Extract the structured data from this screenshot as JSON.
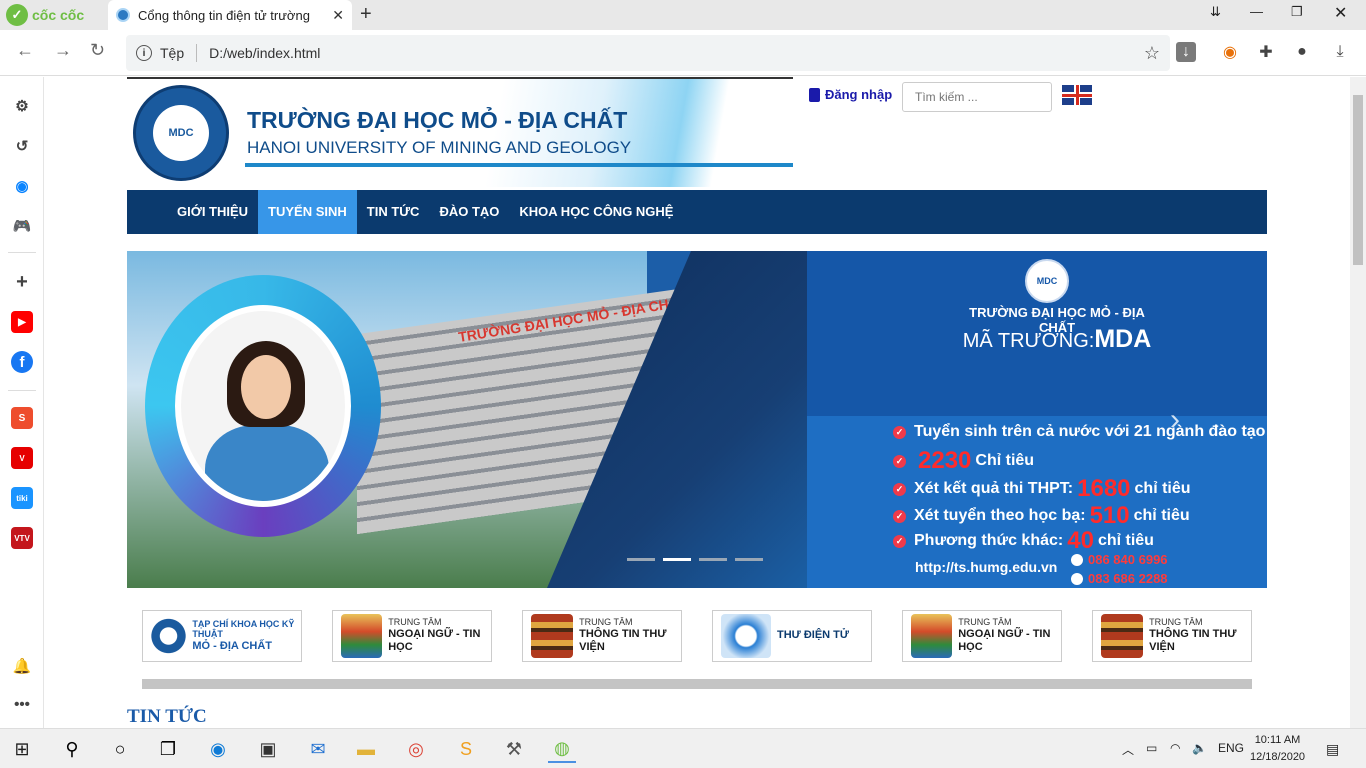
{
  "browser": {
    "brand": "cốc cốc",
    "tab_title": "Cổng thông tin điện tử trường",
    "security_label": "Tệp",
    "url": "D:/web/index.html"
  },
  "header": {
    "name_vn": "TRƯỜNG ĐẠI HỌC MỎ - ĐỊA CHẤT",
    "name_en": "HANOI UNIVERSITY OF MINING AND GEOLOGY",
    "seal_text": "MDC",
    "login": "Đăng nhập",
    "search_placeholder": "Tìm kiếm ..."
  },
  "menu": [
    "GIỚI THIỆU",
    "TUYỂN SINH",
    "TIN TỨC",
    "ĐÀO TẠO",
    "KHOA HỌC CÔNG NGHỆ"
  ],
  "slider": {
    "sign": "TRƯỜNG ĐẠI HỌC MỎ - ĐỊA CHẤT",
    "logo": "MDC",
    "uni": "TRƯỜNG ĐẠI HỌC MỎ - ĐỊA CHẤT",
    "code_prefix": "MÃ TRƯỜNG:",
    "code": "MDA",
    "b1": "Tuyển sinh trên cả nước với 21 ngành đào tạo",
    "b2_num": "2230",
    "b2_text": "Chỉ tiêu",
    "b3_pre": "Xét kết quả thi THPT:",
    "b3_num": "1680",
    "b3_post": "chỉ tiêu",
    "b4_pre": "Xét tuyển theo học bạ:",
    "b4_num": "510",
    "b4_post": "chỉ tiêu",
    "b5_pre": "Phương thức khác:",
    "b5_num": "40",
    "b5_post": "chỉ tiêu",
    "url": "http://ts.humg.edu.vn",
    "phone1": "086 840 6996",
    "phone2": "083 686 2288"
  },
  "quick_links": [
    {
      "small": "TẠP CHÍ KHOA HỌC KỸ THUẬT",
      "big": "MỎ - ĐỊA CHẤT"
    },
    {
      "small": "TRUNG TÂM",
      "big": "NGOẠI NGỮ - TIN HỌC"
    },
    {
      "small": "TRUNG TÂM",
      "big": "THÔNG TIN THƯ VIỆN"
    },
    {
      "small": "",
      "big": "THƯ ĐIỆN TỬ"
    },
    {
      "small": "TRUNG TÂM",
      "big": "NGOẠI NGỮ - TIN HỌC"
    },
    {
      "small": "TRUNG TÂM",
      "big": "THÔNG TIN THƯ VIỆN"
    }
  ],
  "section_title": "TIN TỨC",
  "taskbar": {
    "lang": "ENG",
    "time": "10:11 AM",
    "date": "12/18/2020"
  }
}
